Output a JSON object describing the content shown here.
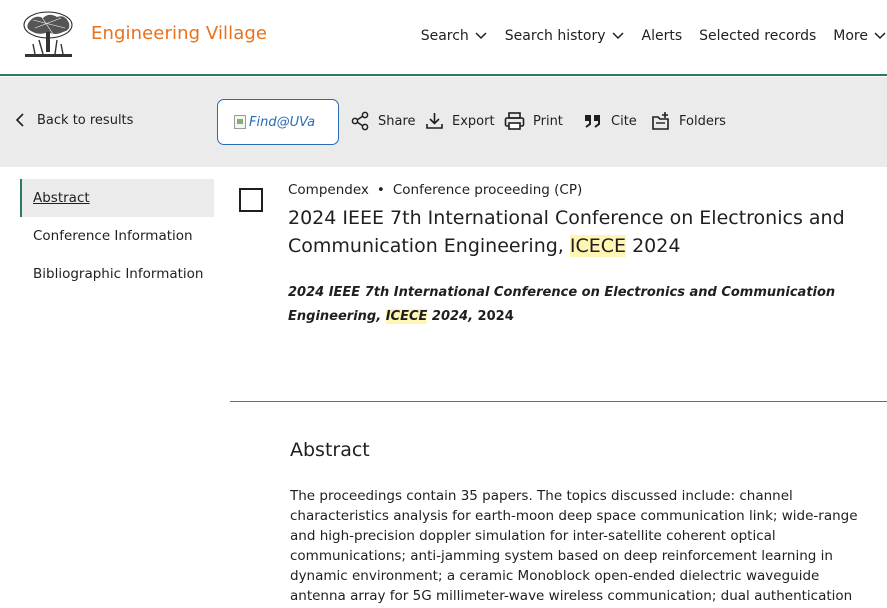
{
  "brand": {
    "name": "Engineering Village",
    "color": "#e9711c"
  },
  "topnav": [
    {
      "label": "Search",
      "has_dropdown": true
    },
    {
      "label": "Search history",
      "has_dropdown": true
    },
    {
      "label": "Alerts",
      "has_dropdown": false
    },
    {
      "label": "Selected records",
      "has_dropdown": false
    },
    {
      "label": "More",
      "has_dropdown": true
    }
  ],
  "toolbar": {
    "back_label": "Back to results",
    "find_alt": "Find@UVa",
    "share_label": "Share",
    "export_label": "Export",
    "print_label": "Print",
    "cite_label": "Cite",
    "folders_label": "Folders"
  },
  "sidenav": {
    "items": [
      {
        "label": "Abstract",
        "active": true
      },
      {
        "label": "Conference Information",
        "active": false
      },
      {
        "label": "Bibliographic Information",
        "active": false
      }
    ]
  },
  "record": {
    "database": "Compendex",
    "doc_type": "Conference proceeding (CP)",
    "title_part1": "2024 IEEE 7th International Conference on Electronics and Communication Engineering, ",
    "title_highlight": "ICECE",
    "title_part2": " 2024",
    "source_part1": "2024 IEEE 7th International Conference on Electronics and Communication Engineering, ",
    "source_highlight": "ICECE",
    "source_part2": " 2024,",
    "source_year": " 2024"
  },
  "abstract": {
    "heading": "Abstract",
    "text": "The proceedings contain 35 papers. The topics discussed include: channel characteristics analysis for earth-moon deep space communication link; wide-range and high-precision doppler simulation for inter-satellite coherent optical communications; anti-jamming system based on deep reinforcement learning in dynamic environment; a ceramic Monoblock open-ended dielectric waveguide antenna array for 5G millimeter-wave wireless communication; dual authentication"
  },
  "colors": {
    "accent": "#2c7a61",
    "link": "#2a6bb5",
    "highlight": "#fff6b3",
    "band": "#ebebeb"
  }
}
